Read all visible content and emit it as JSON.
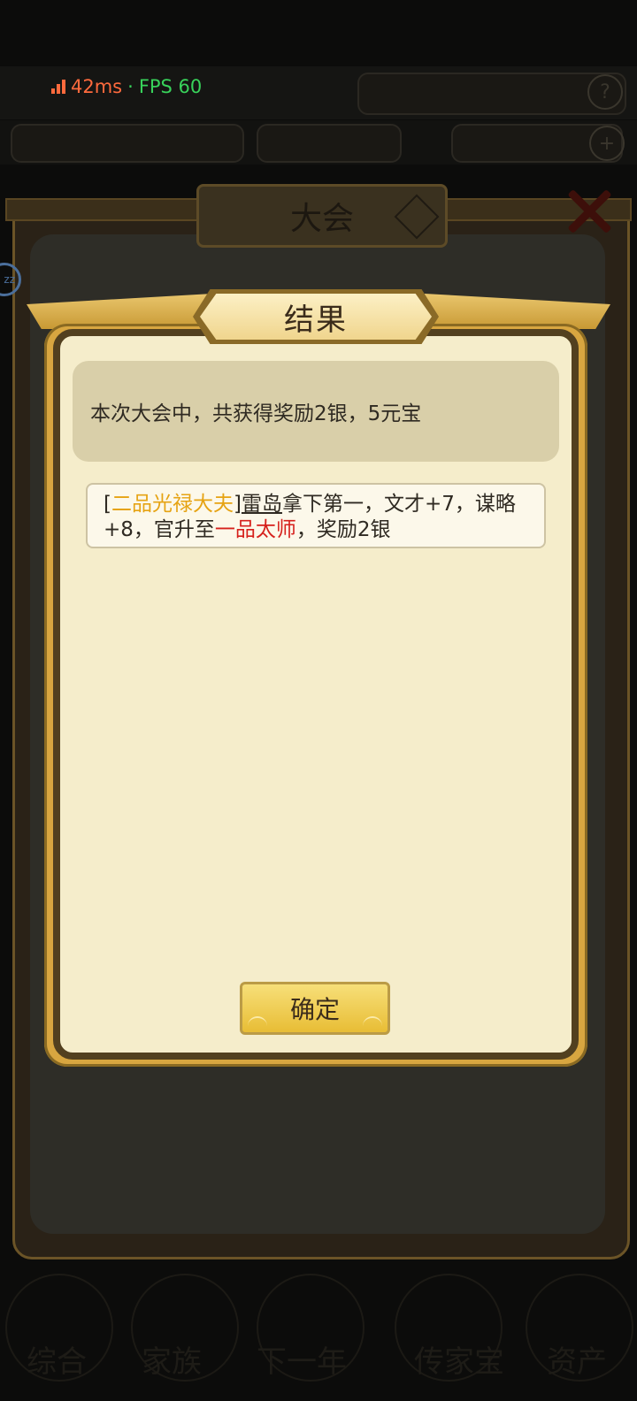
{
  "status": {
    "ping": "42ms",
    "separator": "·",
    "fps": "FPS 60"
  },
  "background": {
    "outer_title": "大会",
    "bottom_nav": [
      "综合",
      "家族",
      "下一年",
      "传家宝",
      "资产"
    ]
  },
  "dialog": {
    "title": "结果",
    "summary": "本次大会中，共获得奖励2银，5元宝",
    "entry": {
      "open_bracket": "[",
      "rank": "二品光禄大夫",
      "close_bracket": "]",
      "name": "雷岛",
      "text1": "拿下第一，文才+7，谋略+8，官升至",
      "promotion": "一品太师",
      "text2": "，奖励2银"
    },
    "confirm_label": "确定"
  },
  "colors": {
    "rank": "#e6a313",
    "promotion": "#d6201c",
    "ping": "#ff6a3d",
    "fps": "#38d25a"
  }
}
